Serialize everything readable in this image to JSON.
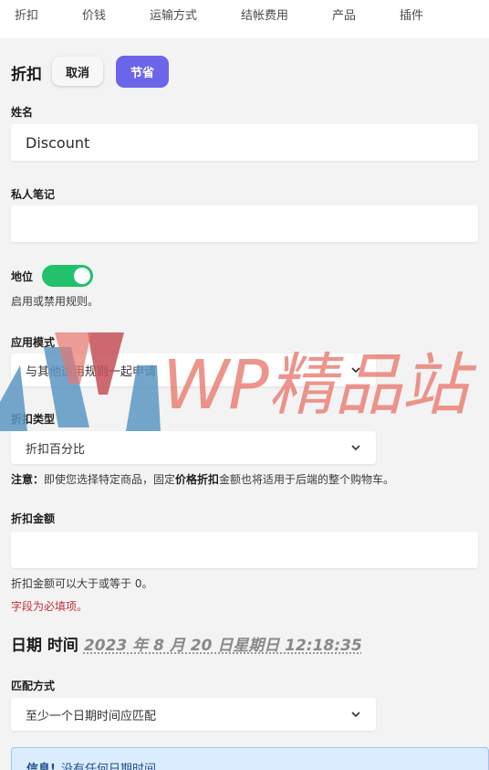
{
  "tabs": [
    "折扣",
    "价钱",
    "运输方式",
    "结帐费用",
    "产品",
    "插件"
  ],
  "header": {
    "title": "折扣",
    "cancel_label": "取消",
    "save_label": "节省"
  },
  "name": {
    "label": "姓名",
    "value": "Discount"
  },
  "note": {
    "label": "私人笔记",
    "value": ""
  },
  "status": {
    "label": "地位",
    "enabled": true,
    "help": "启用或禁用规则。"
  },
  "apply_mode": {
    "label": "应用模式",
    "value": "与其他适用规则一起申请"
  },
  "discount_type": {
    "label": "折扣类型",
    "value": "折扣百分比",
    "note_prefix": "注意：",
    "note_text_1": "即使您选择特定商品，固定",
    "note_bold": "价格折扣",
    "note_text_2": "金额也将适用于后端的整个购物车。"
  },
  "discount_amount": {
    "label": "折扣金额",
    "value": "",
    "help": "折扣金额可以大于或等于 0。",
    "required": "字段为必填项。"
  },
  "datetime": {
    "title": "日期 时间",
    "value": "2023 年 8 月 20 日星期日 12:18:35"
  },
  "match": {
    "label": "匹配方式",
    "value": "至少一个日期时间应匹配"
  },
  "info": {
    "prefix": "信息!",
    "text": "没有任何日期时间"
  },
  "watermark": {
    "text": "WP精品站"
  },
  "colors": {
    "accent": "#6b66e9",
    "toggle_on": "#23c16b",
    "required": "#c0303a",
    "info_bg": "#dcecff"
  }
}
